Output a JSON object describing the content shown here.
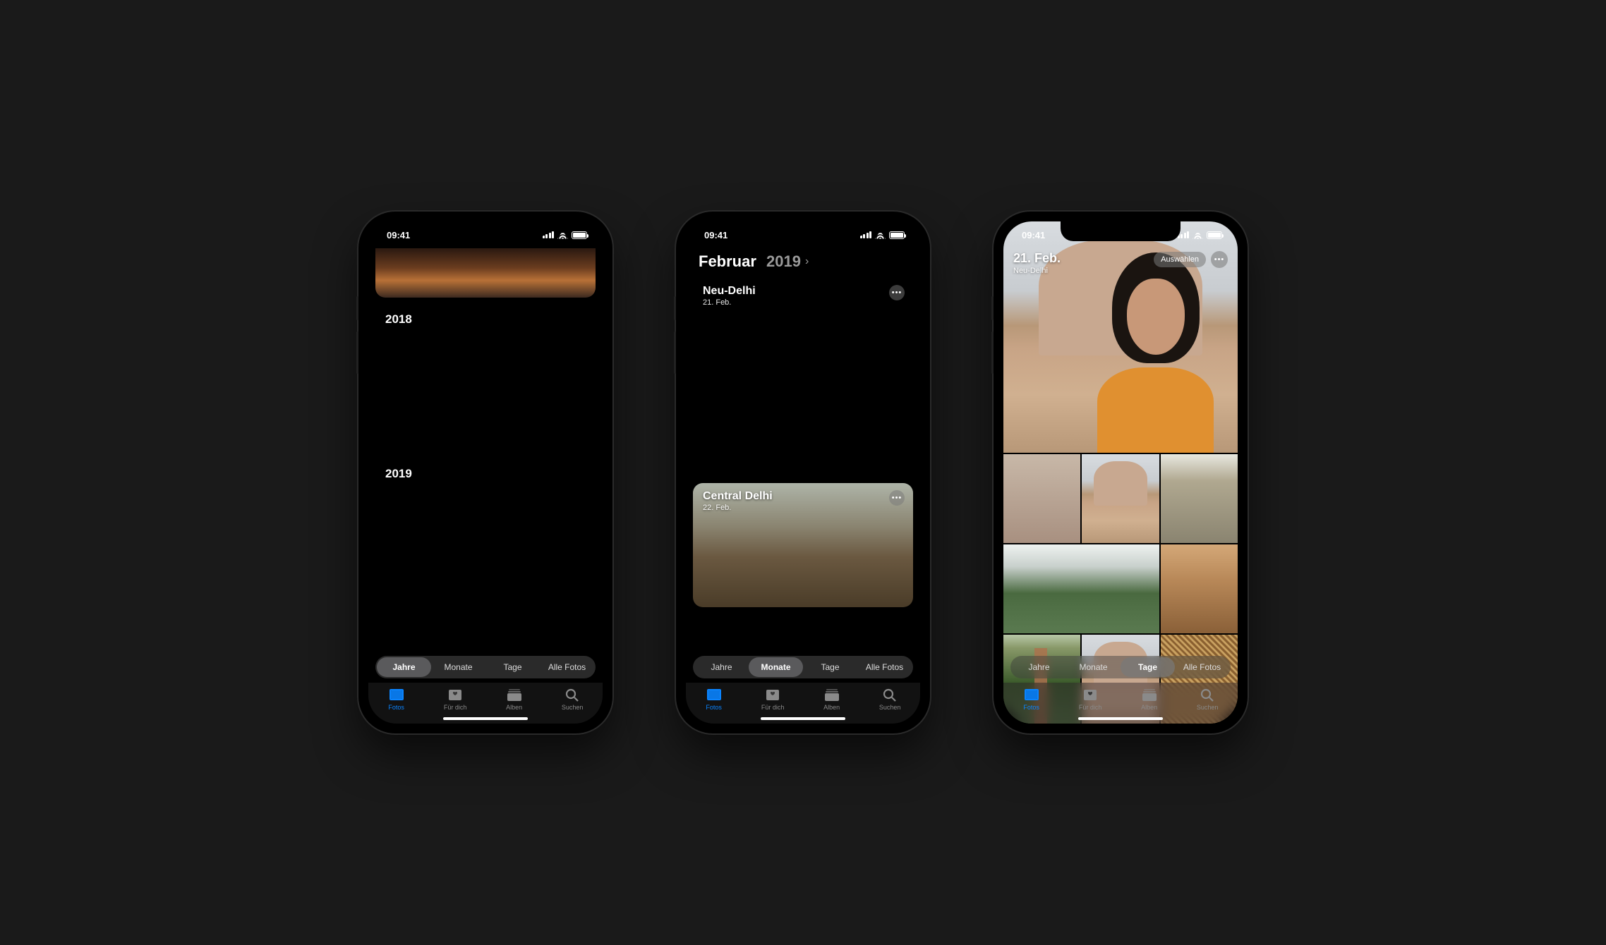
{
  "status": {
    "time": "09:41"
  },
  "segmented": {
    "years": "Jahre",
    "months": "Monate",
    "days": "Tage",
    "all": "Alle Fotos"
  },
  "tabs": {
    "photos": "Fotos",
    "for_you": "Für dich",
    "albums": "Alben",
    "search": "Suchen"
  },
  "phone1": {
    "years": [
      {
        "label": ""
      },
      {
        "label": "2018"
      },
      {
        "label": "2019"
      }
    ]
  },
  "phone2": {
    "header_month": "Februar",
    "header_year": "2019",
    "cards": [
      {
        "title": "Neu-Delhi",
        "subtitle": "21. Feb."
      },
      {
        "title": "Central Delhi",
        "subtitle": "22. Feb."
      }
    ]
  },
  "phone3": {
    "date": "21. Feb.",
    "location": "Neu-Delhi",
    "select_label": "Auswählen"
  }
}
